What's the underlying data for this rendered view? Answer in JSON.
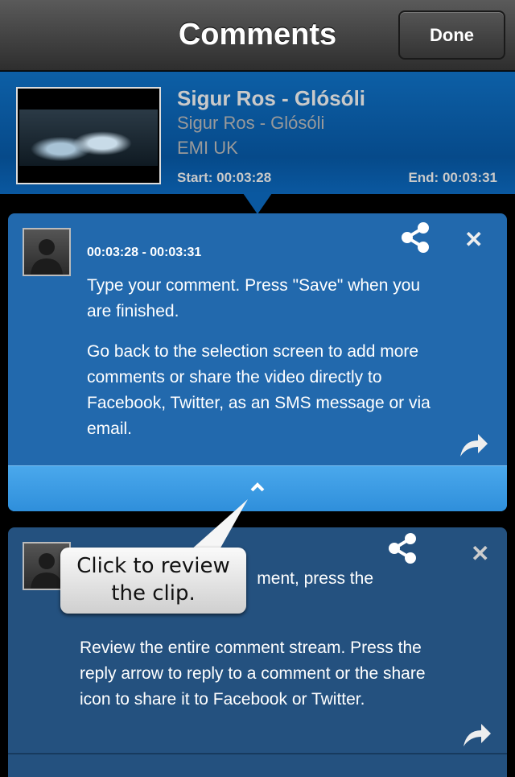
{
  "header": {
    "title": "Comments",
    "done_label": "Done"
  },
  "clip": {
    "title": "Sigur Ros - Glósóli",
    "subtitle": "Sigur Ros - Glósóli",
    "label": "EMI UK",
    "start": "Start: 00:03:28",
    "end": "End: 00:03:31"
  },
  "comments": [
    {
      "timestamp": "00:03:28 - 00:03:31",
      "paragraphs": [
        "Type your comment. Press \"Save\" when you are finished.",
        "Go back to the selection screen to add more comments or share the video directly to Facebook, Twitter, as an SMS message or via email."
      ]
    },
    {
      "partial_line": "ment, press  the",
      "paragraphs": [
        "Review the entire comment  stream. Press the reply arrow to reply to a comment or the share icon to share it to Facebook or Twitter."
      ]
    }
  ],
  "tooltip": {
    "text": "Click to review the clip."
  },
  "colors": {
    "card_active": "#2269ad",
    "card": "#24517f",
    "bar": "#3d9be4"
  }
}
